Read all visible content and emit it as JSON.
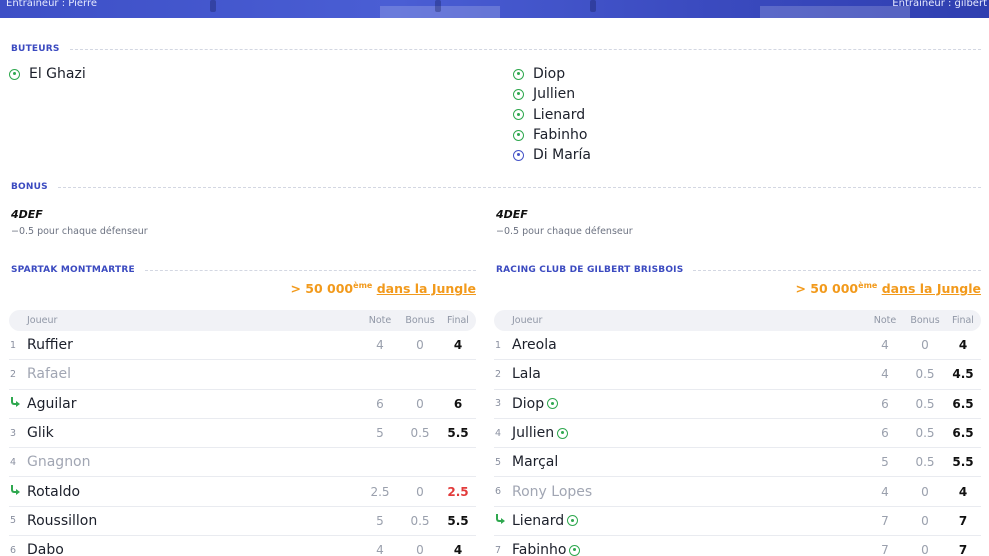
{
  "header": {
    "coach_left": "Entraîneur : Pierre",
    "coach_right": "Entraîneur : gilbert"
  },
  "colors": {
    "accent": "#3b4ac0",
    "goal": "#2fa84f",
    "own_goal": "#4654c7",
    "jungle": "#f29a1c",
    "bad_score": "#e23b3b"
  },
  "scorers": {
    "title": "BUTEURS",
    "left": [
      {
        "name": "El Ghazi",
        "icon": "ball-icon"
      }
    ],
    "right": [
      {
        "name": "Diop",
        "icon": "ball-icon"
      },
      {
        "name": "Jullien",
        "icon": "ball-icon"
      },
      {
        "name": "Lienard",
        "icon": "ball-icon"
      },
      {
        "name": "Fabinho",
        "icon": "ball-icon"
      },
      {
        "name": "Di María",
        "icon": "own-goal-ball-icon"
      }
    ]
  },
  "bonus": {
    "title": "BONUS",
    "left": {
      "name": "4DEF",
      "desc": "−0.5 pour chaque défenseur"
    },
    "right": {
      "name": "4DEF",
      "desc": "−0.5 pour chaque défenseur"
    }
  },
  "teams": [
    {
      "name": "SPARTAK MONTMARTRE",
      "rank_prefix": "> 50 000",
      "rank_suffix": "ème",
      "rank_link": "dans la Jungle",
      "columns": {
        "player": "Joueur",
        "note": "Note",
        "bonus": "Bonus",
        "final": "Final"
      },
      "rows": [
        {
          "num": "1",
          "name": "Ruffier",
          "note": "4",
          "bonus": "0",
          "final": "4"
        },
        {
          "num": "2",
          "name": "Rafael",
          "note": "",
          "bonus": "",
          "final": "",
          "dim": true
        },
        {
          "num": "",
          "name": "Aguilar",
          "note": "6",
          "bonus": "0",
          "final": "6",
          "sub": true
        },
        {
          "num": "3",
          "name": "Glik",
          "note": "5",
          "bonus": "0.5",
          "final": "5.5"
        },
        {
          "num": "4",
          "name": "Gnagnon",
          "note": "",
          "bonus": "",
          "final": "",
          "dim": true
        },
        {
          "num": "",
          "name": "Rotaldo",
          "note": "2.5",
          "bonus": "0",
          "final": "2.5",
          "sub": true,
          "bad": true
        },
        {
          "num": "5",
          "name": "Roussillon",
          "note": "5",
          "bonus": "0.5",
          "final": "5.5"
        },
        {
          "num": "6",
          "name": "Dabo",
          "note": "4",
          "bonus": "0",
          "final": "4"
        }
      ]
    },
    {
      "name": "RACING CLUB DE GILBERT BRISBOIS",
      "rank_prefix": "> 50 000",
      "rank_suffix": "ème",
      "rank_link": "dans la Jungle",
      "columns": {
        "player": "Joueur",
        "note": "Note",
        "bonus": "Bonus",
        "final": "Final"
      },
      "rows": [
        {
          "num": "1",
          "name": "Areola",
          "note": "4",
          "bonus": "0",
          "final": "4"
        },
        {
          "num": "2",
          "name": "Lala",
          "note": "4",
          "bonus": "0.5",
          "final": "4.5"
        },
        {
          "num": "3",
          "name": "Diop",
          "note": "6",
          "bonus": "0.5",
          "final": "6.5",
          "goal": true
        },
        {
          "num": "4",
          "name": "Jullien",
          "note": "6",
          "bonus": "0.5",
          "final": "6.5",
          "goal": true
        },
        {
          "num": "5",
          "name": "Marçal",
          "note": "5",
          "bonus": "0.5",
          "final": "5.5"
        },
        {
          "num": "6",
          "name": "Rony Lopes",
          "note": "4",
          "bonus": "0",
          "final": "4",
          "dim": true
        },
        {
          "num": "",
          "name": "Lienard",
          "note": "7",
          "bonus": "0",
          "final": "7",
          "sub": true,
          "goal": true
        },
        {
          "num": "7",
          "name": "Fabinho",
          "note": "7",
          "bonus": "0",
          "final": "7",
          "goal": true
        }
      ]
    }
  ]
}
